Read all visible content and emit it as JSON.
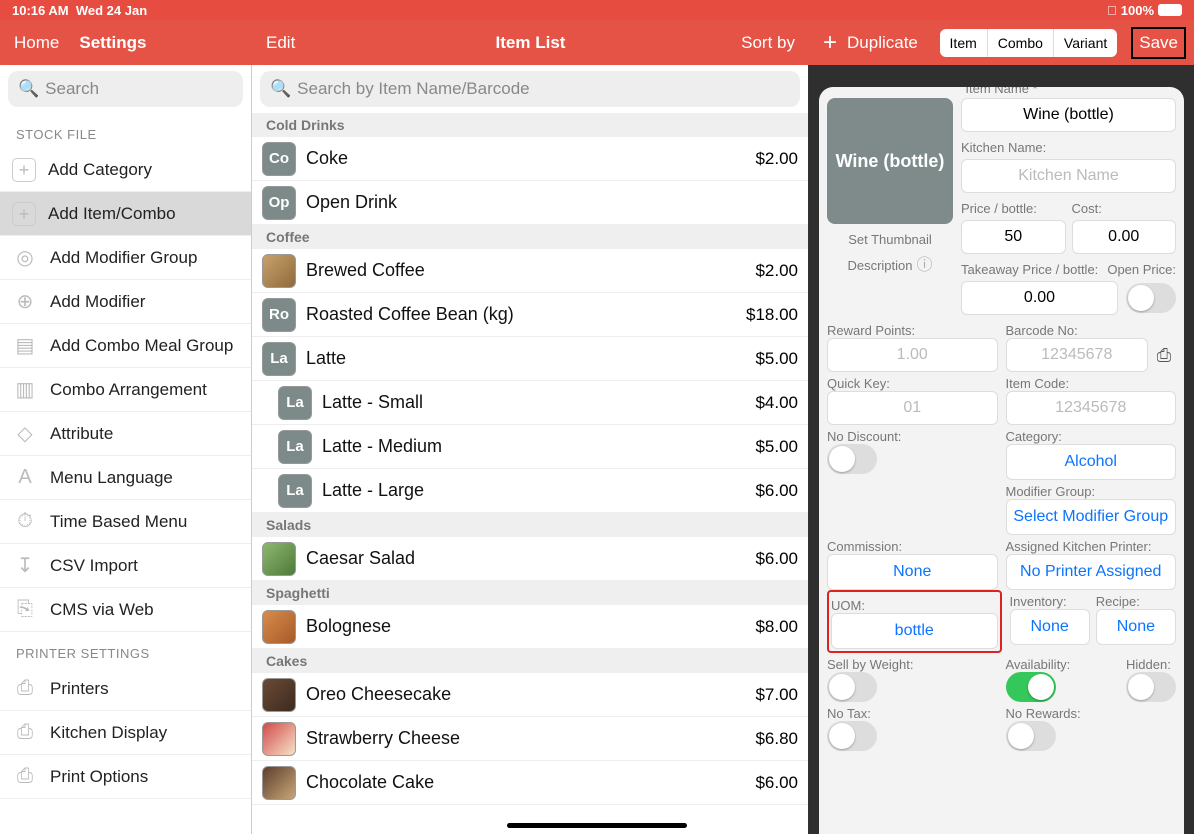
{
  "status": {
    "time": "10:16 AM",
    "date": "Wed 24 Jan",
    "battery": "100%"
  },
  "nav": {
    "home": "Home",
    "settings": "Settings",
    "edit": "Edit",
    "title": "Item List",
    "sort": "Sort by",
    "duplicate": "Duplicate",
    "seg": [
      "Item",
      "Combo",
      "Variant"
    ],
    "save": "Save"
  },
  "left": {
    "search_ph": "Search",
    "section1": "STOCK FILE",
    "items1": [
      "Add Category",
      "Add Item/Combo",
      "Add Modifier Group",
      "Add Modifier",
      "Add Combo Meal Group",
      "Combo Arrangement",
      "Attribute",
      "Menu Language",
      "Time Based Menu",
      "CSV Import",
      "CMS via Web"
    ],
    "section2": "PRINTER SETTINGS",
    "items2": [
      "Printers",
      "Kitchen Display",
      "Print Options"
    ]
  },
  "mid": {
    "search_ph": "Search by Item Name/Barcode",
    "groups": [
      {
        "cat": "Cold Drinks",
        "items": [
          {
            "ab": "Co",
            "name": "Coke",
            "price": "$2.00"
          },
          {
            "ab": "Op",
            "name": "Open Drink",
            "price": ""
          }
        ]
      },
      {
        "cat": "Coffee",
        "items": [
          {
            "img": "coffee",
            "name": "Brewed Coffee",
            "price": "$2.00"
          },
          {
            "ab": "Ro",
            "name": "Roasted Coffee Bean (kg)",
            "price": "$18.00"
          },
          {
            "ab": "La",
            "name": "Latte",
            "price": "$5.00"
          },
          {
            "ab": "La",
            "name": "Latte - Small",
            "price": "$4.00",
            "sub": true
          },
          {
            "ab": "La",
            "name": "Latte - Medium",
            "price": "$5.00",
            "sub": true
          },
          {
            "ab": "La",
            "name": "Latte - Large",
            "price": "$6.00",
            "sub": true
          }
        ]
      },
      {
        "cat": "Salads",
        "items": [
          {
            "img": "salad",
            "name": "Caesar Salad",
            "price": "$6.00"
          }
        ]
      },
      {
        "cat": "Spaghetti",
        "items": [
          {
            "img": "pasta",
            "name": "Bolognese",
            "price": "$8.00"
          }
        ]
      },
      {
        "cat": "Cakes",
        "items": [
          {
            "img": "cake1",
            "name": "Oreo Cheesecake",
            "price": "$7.00"
          },
          {
            "img": "cake2",
            "name": "Strawberry Cheese",
            "price": "$6.80"
          },
          {
            "img": "cake3",
            "name": "Chocolate Cake",
            "price": "$6.00"
          }
        ]
      }
    ]
  },
  "detail": {
    "thumb_text": "Wine (bottle)",
    "set_thumb": "Set Thumbnail",
    "desc_lbl": "Description",
    "item_name_lbl": "Item Name *",
    "item_name": "Wine (bottle)",
    "kitchen_lbl": "Kitchen Name:",
    "kitchen_ph": "Kitchen Name",
    "price_lbl": "Price / bottle:",
    "price_val": "50",
    "cost_lbl": "Cost:",
    "cost_val": "0.00",
    "takeaway_lbl": "Takeaway Price / bottle:",
    "takeaway_val": "0.00",
    "open_price_lbl": "Open Price:",
    "reward_lbl": "Reward Points:",
    "reward_ph": "1.00",
    "barcode_lbl": "Barcode No:",
    "barcode_ph": "12345678",
    "quick_lbl": "Quick Key:",
    "quick_ph": "01",
    "code_lbl": "Item Code:",
    "code_ph": "12345678",
    "nodisc_lbl": "No Discount:",
    "category_lbl": "Category:",
    "category_val": "Alcohol",
    "modgrp_lbl": "Modifier Group:",
    "modgrp_val": "Select Modifier Group",
    "comm_lbl": "Commission:",
    "comm_val": "None",
    "printer_lbl": "Assigned Kitchen Printer:",
    "printer_val": "No Printer Assigned",
    "uom_lbl": "UOM:",
    "uom_val": "bottle",
    "inv_lbl": "Inventory:",
    "inv_val": "None",
    "recipe_lbl": "Recipe:",
    "recipe_val": "None",
    "weight_lbl": "Sell by Weight:",
    "avail_lbl": "Availability:",
    "hidden_lbl": "Hidden:",
    "notax_lbl": "No Tax:",
    "norew_lbl": "No Rewards:"
  }
}
